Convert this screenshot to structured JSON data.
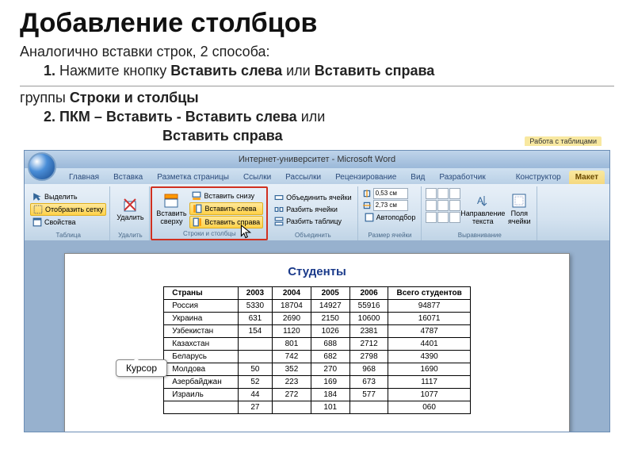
{
  "slide": {
    "title": "Добавление столбцов",
    "line1": "Аналогично вставки строк, 2 способа:",
    "line2a": "1.",
    "line2b": " Нажмите кнопку ",
    "line2c": "Вставить слева",
    "line2d": " или ",
    "line2e": "Вставить справа",
    "line2f": " группы ",
    "line2g": "Строки и столбцы",
    "line3a": "2. ПКМ – Вставить - Вставить слева",
    "line3b": " или",
    "line4": "Вставить справа"
  },
  "window": {
    "title": "Интернет-университет - Microsoft Word",
    "context": "Работа с таблицами"
  },
  "tabs": [
    "Главная",
    "Вставка",
    "Разметка страницы",
    "Ссылки",
    "Рассылки",
    "Рецензирование",
    "Вид",
    "Разработчик",
    "Конструктор",
    "Макет"
  ],
  "ribbon": {
    "g1": {
      "label": "Таблица",
      "select": "Выделить",
      "grid": "Отобразить сетку",
      "props": "Свойства"
    },
    "g2": {
      "label": "Удалить",
      "btn": "Удалить"
    },
    "g3": {
      "label": "Строки и столбцы",
      "top": "Вставить сверху",
      "bottom": "Вставить снизу",
      "left": "Вставить слева",
      "right": "Вставить справа"
    },
    "g4": {
      "label": "Объединить",
      "merge": "Объединить ячейки",
      "split": "Разбить ячейки",
      "splitT": "Разбить таблицу"
    },
    "g5": {
      "label": "Размер ячейки",
      "h": "0,53 см",
      "w": "2,73 см",
      "auto": "Автоподбор"
    },
    "g6": {
      "label": "Выравнивание",
      "dir": "Направление текста",
      "margins": "Поля ячейки"
    }
  },
  "doc": {
    "title": "Студенты",
    "callout": "Курсор"
  },
  "chart_data": {
    "type": "table",
    "headers": [
      "Страны",
      "2003",
      "2004",
      "2005",
      "2006",
      "Всего студентов"
    ],
    "rows": [
      [
        "Россия",
        "5330",
        "18704",
        "14927",
        "55916",
        "94877"
      ],
      [
        "Украина",
        "631",
        "2690",
        "2150",
        "10600",
        "16071"
      ],
      [
        "Узбекистан",
        "154",
        "1120",
        "1026",
        "2381",
        "4787"
      ],
      [
        "Казахстан",
        "",
        "801",
        "688",
        "2712",
        "4401"
      ],
      [
        "Беларусь",
        "",
        "742",
        "682",
        "2798",
        "4390"
      ],
      [
        "Молдова",
        "50",
        "352",
        "270",
        "968",
        "1690"
      ],
      [
        "Азербайджан",
        "52",
        "223",
        "169",
        "673",
        "1117"
      ],
      [
        "Израиль",
        "44",
        "272",
        "184",
        "577",
        "1077"
      ],
      [
        "",
        "27",
        "",
        "101",
        "",
        "060"
      ]
    ]
  }
}
